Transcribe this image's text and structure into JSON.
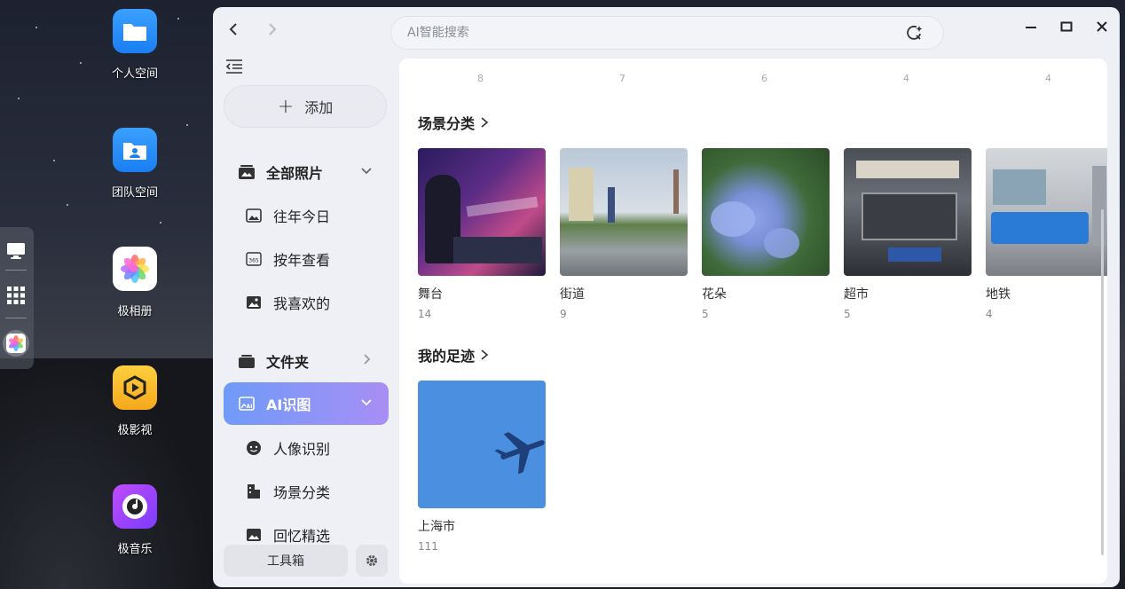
{
  "desktop": {
    "icons": [
      {
        "label": "个人空间",
        "icon": "folder-icon"
      },
      {
        "label": "团队空间",
        "icon": "team-folder-icon"
      },
      {
        "label": "极相册",
        "icon": "photos-icon"
      },
      {
        "label": "极影视",
        "icon": "video-icon"
      },
      {
        "label": "极音乐",
        "icon": "music-icon"
      }
    ],
    "dock": [
      "desktop-icon",
      "app-grid-icon",
      "photos-icon"
    ]
  },
  "window": {
    "search": {
      "placeholder": "AI智能搜索"
    },
    "sidebar": {
      "add_label": "添加",
      "items": [
        {
          "label": "全部照片",
          "icon": "photos-stack-icon",
          "level": "top",
          "chevron": "down"
        },
        {
          "label": "往年今日",
          "icon": "image-icon",
          "level": "sub"
        },
        {
          "label": "按年查看",
          "icon": "calendar-365-icon",
          "level": "sub"
        },
        {
          "label": "我喜欢的",
          "icon": "heart-image-icon",
          "level": "sub"
        },
        {
          "label": "文件夹",
          "icon": "folder-stack-icon",
          "level": "top",
          "chevron": "right"
        },
        {
          "label": "AI识图",
          "icon": "ai-image-icon",
          "level": "top",
          "chevron": "down",
          "active": true
        },
        {
          "label": "人像识别",
          "icon": "face-icon",
          "level": "sub"
        },
        {
          "label": "场景分类",
          "icon": "building-icon",
          "level": "sub"
        },
        {
          "label": "回忆精选",
          "icon": "image-icon",
          "level": "sub"
        }
      ],
      "toolbox_label": "工具箱"
    },
    "content": {
      "ghost_counts": [
        "8",
        "7",
        "6",
        "4",
        "4"
      ],
      "scenes": {
        "title": "场景分类",
        "items": [
          {
            "name": "舞台",
            "count": "14"
          },
          {
            "name": "街道",
            "count": "9"
          },
          {
            "name": "花朵",
            "count": "5"
          },
          {
            "name": "超市",
            "count": "5"
          },
          {
            "name": "地铁",
            "count": "4"
          }
        ]
      },
      "footprints": {
        "title": "我的足迹",
        "items": [
          {
            "name": "上海市",
            "count": "111"
          }
        ]
      }
    }
  },
  "colors": {
    "active_start": "#6f9bf8",
    "active_end": "#a88ef5"
  }
}
